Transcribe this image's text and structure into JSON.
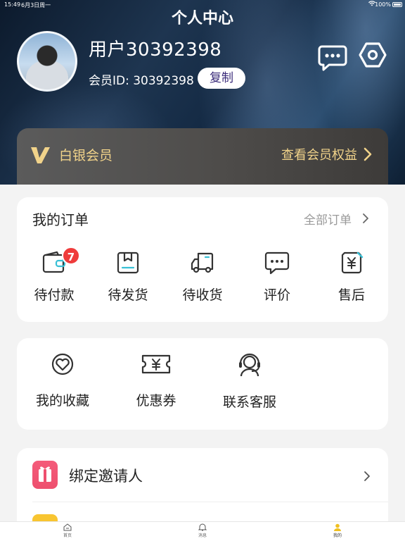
{
  "status_bar": {
    "time": "15:49",
    "date": "6月3日周一",
    "battery": "100%"
  },
  "header": {
    "title": "个人中心"
  },
  "profile": {
    "username": "用户30392398",
    "member_id": "会员ID: 30392398",
    "copy_label": "复制"
  },
  "vip": {
    "level": "白银会员",
    "benefits_label": "查看会员权益",
    "accent_color": "#f1d38a"
  },
  "orders": {
    "title": "我的订单",
    "all_label": "全部订单",
    "items": [
      {
        "label": "待付款",
        "icon": "wallet-icon",
        "badge": "7"
      },
      {
        "label": "待发货",
        "icon": "package-icon"
      },
      {
        "label": "待收货",
        "icon": "truck-icon"
      },
      {
        "label": "评价",
        "icon": "chat-bubble-icon"
      },
      {
        "label": "售后",
        "icon": "yuan-shield-icon"
      }
    ],
    "badge_color": "#ef3b3b"
  },
  "tools": {
    "items": [
      {
        "label": "我的收藏",
        "icon": "heart-icon"
      },
      {
        "label": "优惠券",
        "icon": "coupon-icon"
      },
      {
        "label": "联系客服",
        "icon": "headset-icon"
      }
    ]
  },
  "list": {
    "items": [
      {
        "label": "绑定邀请人",
        "icon": "gift-icon"
      }
    ]
  },
  "tabbar": {
    "items": [
      {
        "label": "首页",
        "icon": "home-icon"
      },
      {
        "label": "消息",
        "icon": "bell-icon"
      },
      {
        "label": "我的",
        "icon": "user-icon",
        "active": true
      }
    ],
    "active_color": "#f0c020"
  }
}
